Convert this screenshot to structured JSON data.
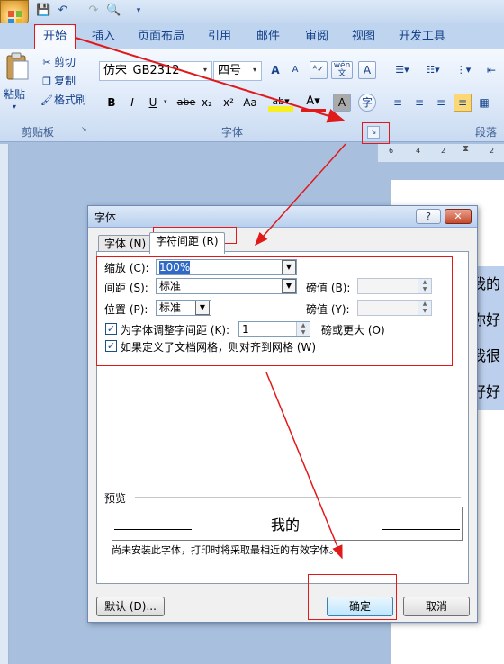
{
  "ribbon": {
    "tabs": [
      "开始",
      "插入",
      "页面布局",
      "引用",
      "邮件",
      "审阅",
      "视图",
      "开发工具"
    ],
    "clipboard": {
      "paste": "粘贴",
      "cut": "剪切",
      "copy": "复制",
      "format_painter": "格式刷",
      "group_label": "剪贴板"
    },
    "font": {
      "name": "仿宋_GB2312",
      "size": "四号",
      "group_label": "字体",
      "buttons": [
        "A",
        "A",
        "Aa",
        "A",
        "B",
        "I",
        "U",
        "abe",
        "x₂",
        "x²",
        "A",
        "A",
        "A"
      ],
      "pinyin": "wén"
    },
    "paragraph": {
      "group_label": "段落"
    }
  },
  "ruler": {
    "ticks": [
      "6",
      "4",
      "2",
      "2"
    ]
  },
  "document": {
    "lines": [
      "我的",
      "你好",
      "我很",
      "好好"
    ]
  },
  "dialog": {
    "title": "字体",
    "help": "?",
    "close": "✕",
    "tabs": [
      "字体 (N)",
      "字符间距 (R)"
    ],
    "scale_label": "缩放 (C):",
    "scale_value": "100%",
    "spacing_label": "间距 (S):",
    "spacing_value": "标准",
    "spacing_by_label": "磅值 (B):",
    "spacing_by_value": "",
    "position_label": "位置 (P):",
    "position_value": "标准",
    "position_by_label": "磅值 (Y):",
    "position_by_value": "",
    "kerning_label": "为字体调整字间距 (K):",
    "kerning_checked": true,
    "kerning_value": "1",
    "kerning_suffix": "磅或更大 (O)",
    "grid_label": "如果定义了文档网格，则对齐到网格 (W)",
    "grid_checked": true,
    "preview_label": "预览",
    "preview_text": "我的",
    "preview_note": "尚未安装此字体，打印时将采取最相近的有效字体。",
    "default_button": "默认 (D)...",
    "ok_button": "确定",
    "cancel_button": "取消"
  },
  "colors": {
    "annotation": "#e0191b",
    "ribbon_text": "#15428b"
  }
}
